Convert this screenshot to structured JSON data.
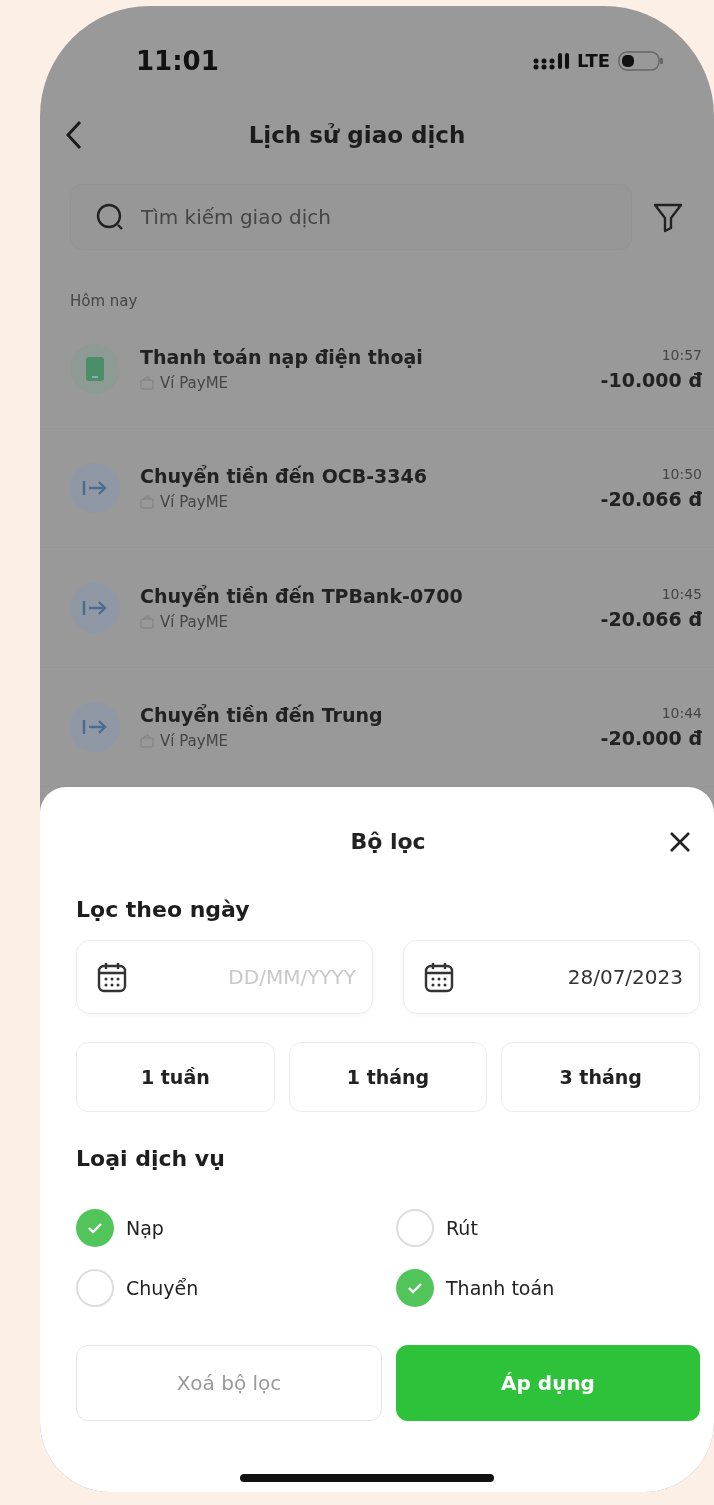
{
  "status_bar": {
    "time": "11:01",
    "network": "LTE"
  },
  "header": {
    "title": "Lịch sử giao dịch"
  },
  "search": {
    "placeholder": "Tìm kiếm giao dịch"
  },
  "section": "Hôm nay",
  "transactions": [
    {
      "kind": "topup",
      "title": "Thanh toán nạp điện thoại",
      "source": "Ví PayME",
      "time": "10:57",
      "amount": "-10.000 đ"
    },
    {
      "kind": "transfer",
      "title": "Chuyển tiền đến OCB-3346",
      "source": "Ví PayME",
      "time": "10:50",
      "amount": "-20.066 đ"
    },
    {
      "kind": "transfer",
      "title": "Chuyển tiền đến TPBank-0700",
      "source": "Ví PayME",
      "time": "10:45",
      "amount": "-20.066 đ"
    },
    {
      "kind": "transfer",
      "title": "Chuyển tiền đến Trung",
      "source": "Ví PayME",
      "time": "10:44",
      "amount": "-20.000 đ"
    }
  ],
  "filter": {
    "title": "Bộ lọc",
    "date_heading": "Lọc theo ngày",
    "from_date": {
      "placeholder": "DD/MM/YYYY"
    },
    "to_date": {
      "value": "28/07/2023"
    },
    "periods": [
      {
        "label": "1 tuần",
        "selected": false
      },
      {
        "label": "1 tháng",
        "selected": false
      },
      {
        "label": "3 tháng",
        "selected": false
      }
    ],
    "service_heading": "Loại dịch vụ",
    "services": [
      {
        "label": "Nạp",
        "checked": true
      },
      {
        "label": "Rút",
        "checked": false
      },
      {
        "label": "Chuyển",
        "checked": false
      },
      {
        "label": "Thanh toán",
        "checked": true
      }
    ],
    "clear_button": {
      "label": "Xoá bộ lọc",
      "disabled": true
    },
    "apply_button": {
      "label": "Áp dụng"
    }
  }
}
